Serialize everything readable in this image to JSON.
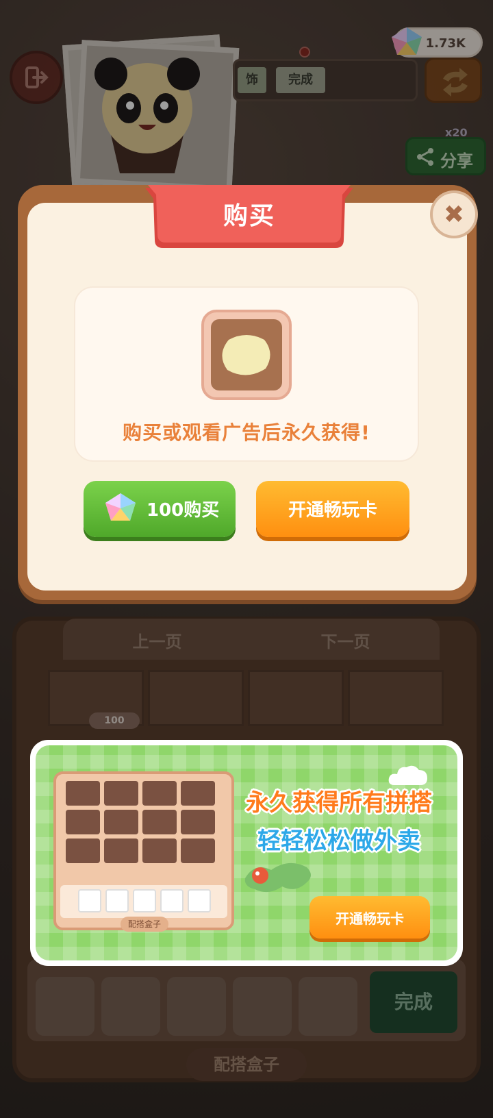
{
  "top_bar": {
    "gem_count": "1.73K",
    "tabs": [
      "饰",
      "完成"
    ],
    "share_label": "分享",
    "share_reward": "x20"
  },
  "dialog": {
    "title": "购买",
    "message": "购买或观看广告后永久获得!",
    "buy_button_label": "100购买",
    "card_button_label": "开通畅玩卡"
  },
  "cabinet": {
    "prev_page": "上一页",
    "next_page": "下一页",
    "item_price": "100",
    "done_label": "完成",
    "box_label": "配搭盒子"
  },
  "ad_banner": {
    "line1": "永久获得所有拼搭",
    "line2": "轻轻松松做外卖",
    "button_label": "开通畅玩卡",
    "box_label": "配搭盒子"
  },
  "colors": {
    "dialog_title_bg": "#f0615a",
    "buy_button": "#5cb832",
    "card_button": "#ff9f1c",
    "message_text": "#e9813a"
  }
}
